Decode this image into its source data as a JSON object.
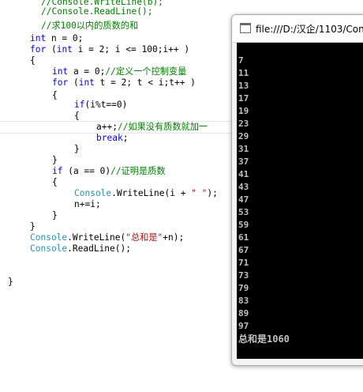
{
  "editor": {
    "lines": [
      [
        {
          "c": "cm",
          "t": "//Console.WriteLine(b);"
        }
      ],
      [
        {
          "c": "cm",
          "t": "//Console.ReadLine();"
        }
      ],
      [
        {
          "c": "cm",
          "t": "//求100以内的质数的和"
        }
      ],
      [
        {
          "c": "kw",
          "t": "int"
        },
        {
          "c": "tx",
          "t": " n = 0;"
        }
      ],
      [
        {
          "c": "kw",
          "t": "for"
        },
        {
          "c": "tx",
          "t": " ("
        },
        {
          "c": "kw",
          "t": "int"
        },
        {
          "c": "tx",
          "t": " i = 2; i <= 100;i++ )"
        }
      ],
      [
        {
          "c": "tx",
          "t": "{"
        }
      ],
      [
        {
          "c": "kw",
          "t": "int"
        },
        {
          "c": "tx",
          "t": " a = 0;"
        },
        {
          "c": "cm",
          "t": "//定义一个控制变量"
        }
      ],
      [
        {
          "c": "kw",
          "t": "for"
        },
        {
          "c": "tx",
          "t": " ("
        },
        {
          "c": "kw",
          "t": "int"
        },
        {
          "c": "tx",
          "t": " t = 2; t < i;t++ )"
        }
      ],
      [
        {
          "c": "tx",
          "t": "{"
        }
      ],
      [
        {
          "c": "kw",
          "t": "if"
        },
        {
          "c": "tx",
          "t": "(i%t==0)"
        }
      ],
      [
        {
          "c": "tx",
          "t": "{"
        }
      ],
      [
        {
          "c": "tx",
          "t": "a++;"
        },
        {
          "c": "cm",
          "t": "//如果没有质数就加一"
        }
      ],
      [
        {
          "c": "kw",
          "t": "break"
        },
        {
          "c": "tx",
          "t": ";"
        }
      ],
      [
        {
          "c": "tx",
          "t": "}"
        }
      ],
      [
        {
          "c": "tx",
          "t": "}"
        }
      ],
      [
        {
          "c": "kw",
          "t": "if"
        },
        {
          "c": "tx",
          "t": " (a == 0)"
        },
        {
          "c": "cm",
          "t": "//证明是质数"
        }
      ],
      [
        {
          "c": "tx",
          "t": "{"
        }
      ],
      [
        {
          "c": "id",
          "t": "Console"
        },
        {
          "c": "tx",
          "t": ".WriteLine(i + "
        },
        {
          "c": "st",
          "t": "\" \""
        },
        {
          "c": "tx",
          "t": ");"
        }
      ],
      [
        {
          "c": "tx",
          "t": "n+=i;"
        }
      ],
      [
        {
          "c": "tx",
          "t": "}"
        }
      ],
      [
        {
          "c": "tx",
          "t": "}"
        }
      ],
      [
        {
          "c": "id",
          "t": "Console"
        },
        {
          "c": "tx",
          "t": ".WriteLine("
        },
        {
          "c": "st",
          "t": "\"总和是\""
        },
        {
          "c": "tx",
          "t": "+n);"
        }
      ],
      [
        {
          "c": "id",
          "t": "Console"
        },
        {
          "c": "tx",
          "t": ".ReadLine();"
        }
      ],
      [],
      [],
      [
        {
          "c": "tx",
          "t": "}"
        }
      ]
    ]
  },
  "console": {
    "title": "file:///D:/汉企/1103/Con",
    "output": [
      "7",
      "11",
      "13",
      "17",
      "19",
      "23",
      "29",
      "31",
      "37",
      "41",
      "43",
      "47",
      "53",
      "59",
      "61",
      "67",
      "71",
      "73",
      "79",
      "83",
      "89",
      "97"
    ],
    "sum_line": "总和是1060",
    "colors": {
      "background": "#000000",
      "text": "#c0c0c0"
    }
  }
}
